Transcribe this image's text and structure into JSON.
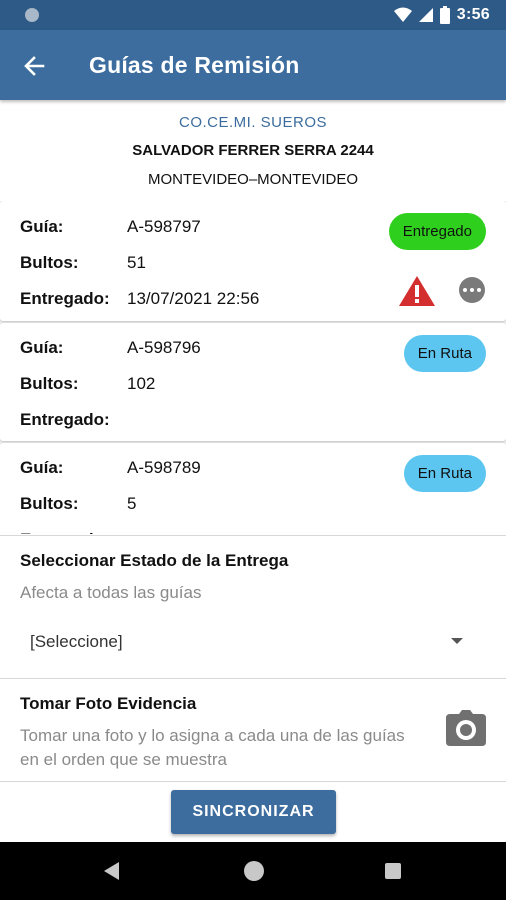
{
  "status_bar": {
    "time": "3:56"
  },
  "app_bar": {
    "title": "Guías de Remisión",
    "back_icon": "arrow-left-icon"
  },
  "client": {
    "name": "CO.CE.MI.  SUEROS",
    "address": "SALVADOR FERRER SERRA 2244",
    "city": "MONTEVIDEO–MONTEVIDEO"
  },
  "labels": {
    "guia": "Guía:",
    "bultos": "Bultos:",
    "entregado": "Entregado:"
  },
  "guides": [
    {
      "guia": "A-598797",
      "bultos": "51",
      "entregado": "13/07/2021 22:56",
      "status": "Entregado",
      "status_color": "#2fd01d",
      "has_warning": true,
      "has_more": true
    },
    {
      "guia": "A-598796",
      "bultos": "102",
      "entregado": "",
      "status": "En Ruta",
      "status_color": "#5cc6f0"
    },
    {
      "guia": "A-598789",
      "bultos": "5",
      "entregado": "",
      "status": "En Ruta",
      "status_color": "#5cc6f0"
    }
  ],
  "delivery_state": {
    "title": "Seleccionar Estado de la Entrega",
    "subtitle": "Afecta a todas las guías",
    "selected": "[Seleccione]"
  },
  "photo": {
    "title": "Tomar Foto Evidencia",
    "description": "Tomar una foto y lo asigna a cada una de las guías en el orden que se muestra",
    "icon": "camera-icon"
  },
  "sync_button": "SINCRONIZAR",
  "colors": {
    "primary": "#3c6d9e",
    "status_bar": "#2d5a86",
    "warning": "#d32f2f"
  }
}
